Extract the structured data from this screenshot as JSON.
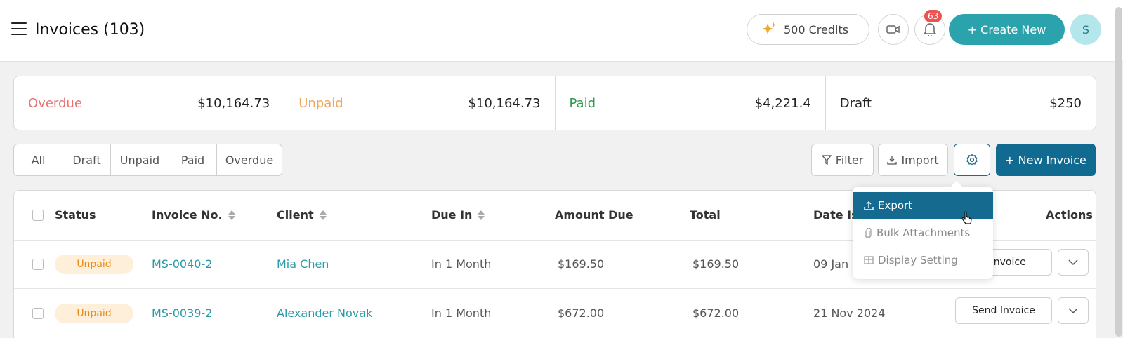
{
  "header": {
    "title": "Invoices (103)",
    "credits_label": "500 Credits",
    "notification_count": "63",
    "create_new_label": "+ Create New",
    "avatar_initial": "S"
  },
  "summary": [
    {
      "label": "Overdue",
      "amount": "$10,164.73",
      "color": "#e57373"
    },
    {
      "label": "Unpaid",
      "amount": "$10,164.73",
      "color": "#f0a55a"
    },
    {
      "label": "Paid",
      "amount": "$4,221.4",
      "color": "#2e9a4c"
    },
    {
      "label": "Draft",
      "amount": "$250",
      "color": "#222222"
    }
  ],
  "filter_tabs": [
    "All",
    "Draft",
    "Unpaid",
    "Paid",
    "Overdue"
  ],
  "toolbar": {
    "filter_label": "Filter",
    "import_label": "Import",
    "new_invoice_label": "+ New Invoice"
  },
  "table": {
    "columns": [
      "Status",
      "Invoice No.",
      "Client",
      "Due In",
      "Amount Due",
      "Total",
      "Date Is",
      "Actions"
    ],
    "rows": [
      {
        "status": "Unpaid",
        "invoice_no": "MS-0040-2",
        "client": "Mia Chen",
        "due_in": "In 1 Month",
        "amount_due": "$169.50",
        "total": "$169.50",
        "date_issued": "09 Jan",
        "action": "d Invoice"
      },
      {
        "status": "Unpaid",
        "invoice_no": "MS-0039-2",
        "client": "Alexander Novak",
        "due_in": "In 1 Month",
        "amount_due": "$672.00",
        "total": "$672.00",
        "date_issued": "21 Nov 2024",
        "action": "Send Invoice"
      }
    ]
  },
  "dropdown": {
    "items": [
      "Export",
      "Bulk Attachments",
      "Display Setting"
    ],
    "active_index": 0
  },
  "colors": {
    "accent_teal": "#2ba3ad",
    "primary_blue": "#116a8f",
    "unpaid_orange": "#e88a1a",
    "link_teal": "#2a9aa6"
  }
}
